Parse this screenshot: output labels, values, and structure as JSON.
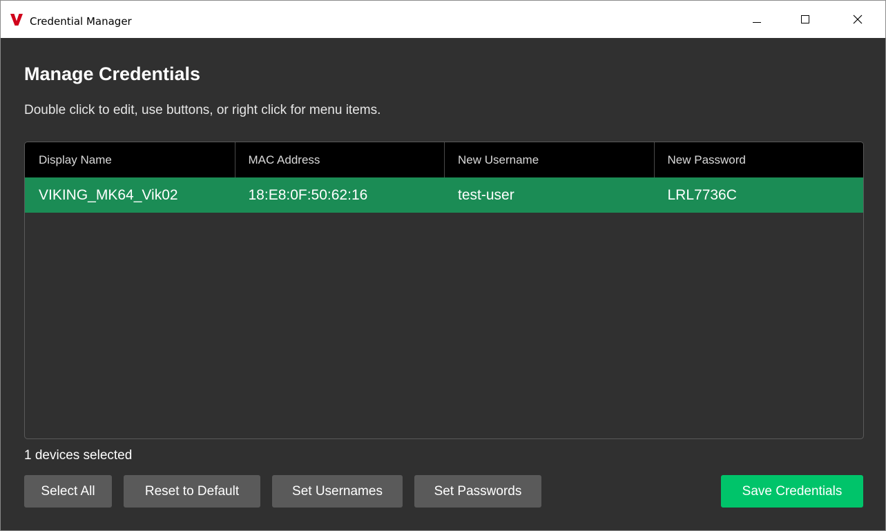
{
  "window": {
    "title": "Credential Manager",
    "logo_icon": "viking-v-logo-icon",
    "controls": [
      "minimize-icon",
      "maximize-icon",
      "close-icon"
    ]
  },
  "main": {
    "heading": "Manage Credentials",
    "instructions": "Double click to edit, use buttons, or right click for menu items."
  },
  "table": {
    "columns": [
      "Display Name",
      "MAC Address",
      "New Username",
      "New Password"
    ],
    "rows": [
      {
        "display_name": "VIKING_MK64_Vik02",
        "mac_address": "18:E8:0F:50:62:16",
        "new_username": "test-user",
        "new_password": "LRL7736C",
        "selected": true
      }
    ]
  },
  "status": {
    "selection_text": "1 devices selected"
  },
  "buttons": {
    "select_all": "Select All",
    "reset_to_default": "Reset to Default",
    "set_usernames": "Set Usernames",
    "set_passwords": "Set Passwords",
    "save_credentials": "Save Credentials"
  },
  "colors": {
    "background": "#303030",
    "header_background": "#000000",
    "selected_row": "#1b8c55",
    "button": "#5a5a5a",
    "primary_button": "#00c46a",
    "logo": "#d0021b"
  }
}
